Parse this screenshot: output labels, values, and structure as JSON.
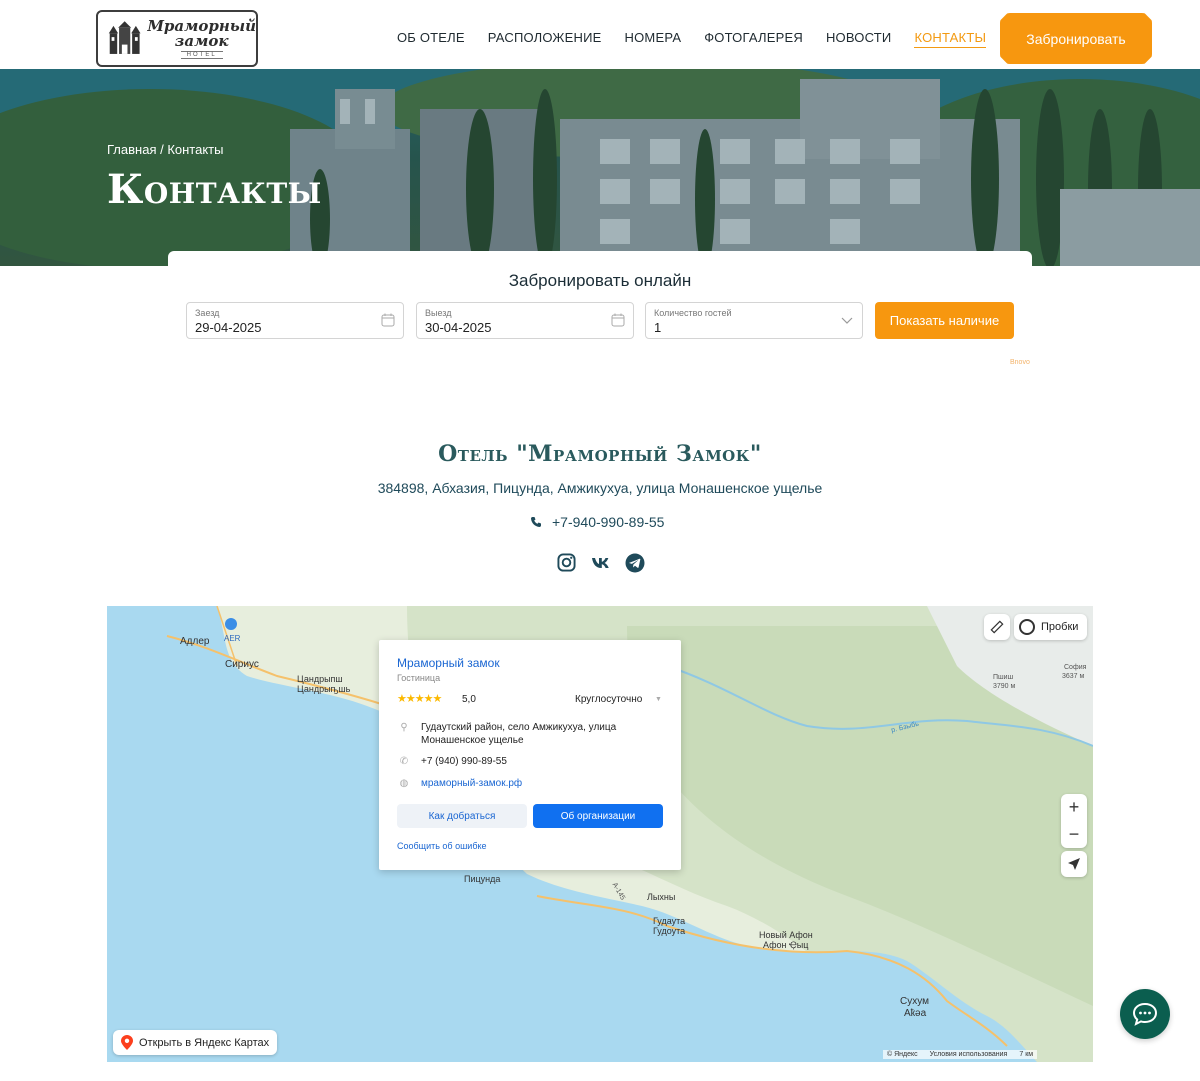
{
  "header": {
    "logo": {
      "line1": "Мраморный",
      "line2": "замок",
      "line3": "HOTEL"
    },
    "nav": [
      {
        "label": "Об отеле",
        "active": false
      },
      {
        "label": "Расположение",
        "active": false
      },
      {
        "label": "Номера",
        "active": false
      },
      {
        "label": "Фотогалерея",
        "active": false
      },
      {
        "label": "Новости",
        "active": false
      },
      {
        "label": "Контакты",
        "active": true
      }
    ],
    "book_label": "Забронировать",
    "accent_color": "#f7970f"
  },
  "hero": {
    "breadcrumb": "Главная / Контакты",
    "title": "Контакты"
  },
  "booking": {
    "title": "Забронировать онлайн",
    "checkin": {
      "label": "Заезд",
      "value": "29-04-2025"
    },
    "checkout": {
      "label": "Выезд",
      "value": "30-04-2025"
    },
    "guests": {
      "label": "Количество гостей",
      "value": "1"
    },
    "submit_label": "Показать наличие",
    "powered_by": "Bnovo"
  },
  "contacts": {
    "hotel_name": "Отель \"Мраморный Замок\"",
    "address": "384898, Абхазия, Пицунда, Амжикухуа, улица Монашенское ущелье",
    "phone": "+7-940-990-89-55",
    "socials": [
      "instagram-icon",
      "vk-icon",
      "telegram-icon"
    ]
  },
  "map": {
    "popup": {
      "name": "Мраморный замок",
      "type": "Гостиница",
      "stars": "★★★★★",
      "rating": "5,0",
      "hours": "Круглосуточно",
      "address": "Гудаутский район, село Амжикухуа, улица Монашенское ущелье",
      "phone": "+7 (940) 990-89-55",
      "website": "мраморный-замок.рф",
      "route_label": "Как добраться",
      "about_label": "Об организации",
      "report_label": "Сообщить об ошибке"
    },
    "labels": {
      "adler": "Адлер",
      "aer": "AER",
      "sirius": "Сириус",
      "tsandrypsh1": "Цандрыпш",
      "tsandrypsh2": "Цандрыҧшь",
      "pitsunda": "Пицунда",
      "lykhny": "Лыхны",
      "gudauta1": "Гудаута",
      "gudauta2": "Гудоута",
      "novy_afon1": "Новый Афон",
      "novy_afon2": "Афон Ҿыц",
      "sukhum1": "Сухум",
      "sukhum2": "Аҟәа",
      "psha": "Пшиш",
      "psha_h": "3790 м",
      "sofia": "София",
      "sofia_h": "3637 м",
      "river": "р. Бзыбь",
      "road": "А-145"
    },
    "traffic_label": "Пробки",
    "open_label": "Открыть в Яндекс Картах",
    "copyright": "© Яндекс",
    "terms": "Условия использования",
    "scale": "7 км"
  }
}
